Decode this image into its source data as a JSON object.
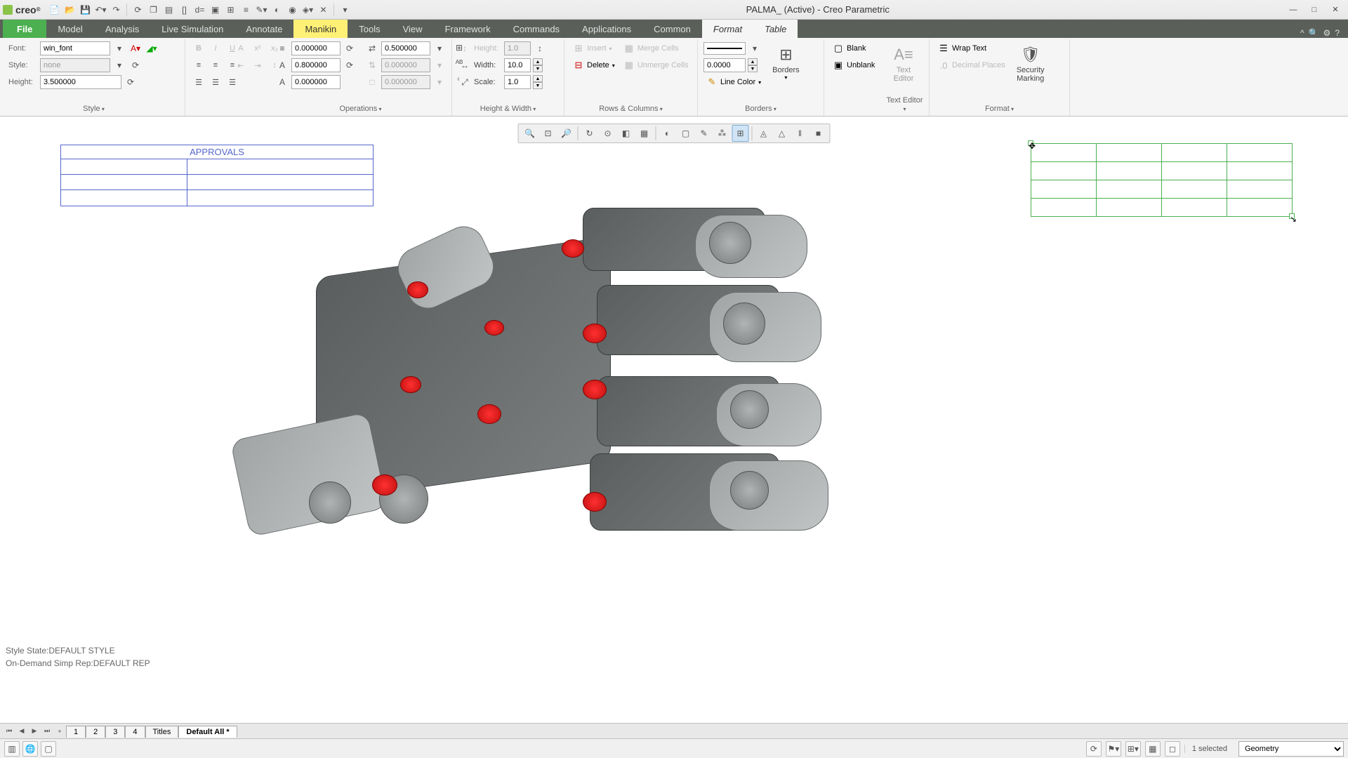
{
  "app": {
    "logo": "creo",
    "title_doc": "PALMA_ (Active)",
    "title_app": "Creo Parametric"
  },
  "qat": [
    "new",
    "open",
    "save",
    "undo",
    "redo",
    "regenerate",
    "windows",
    "close",
    "d1",
    "d2",
    "go",
    "refit",
    "dims",
    "model",
    "style",
    "render",
    "render2",
    "close2",
    "more"
  ],
  "window_controls": {
    "min": "—",
    "max": "□",
    "close": "✕"
  },
  "tabs": {
    "file": "File",
    "items": [
      "Model",
      "Analysis",
      "Live Simulation",
      "Annotate",
      "Manikin",
      "Tools",
      "View",
      "Framework",
      "Commands",
      "Applications",
      "Common",
      "Format",
      "Table"
    ],
    "active_italic": [
      "Format",
      "Table"
    ],
    "highlighted": "Manikin"
  },
  "ribbon": {
    "font": {
      "label": "Font:",
      "value": "win_font"
    },
    "style": {
      "label": "Style:",
      "value": "none"
    },
    "height": {
      "label": "Height:",
      "value": "3.500000"
    },
    "group_style": "Style",
    "line_spacing": "0.000000",
    "char_spacing": "0.800000",
    "kerning": "0.000000",
    "margin_horiz": "0.500000",
    "margin_vert": "0.000000",
    "margin_other": "0.000000",
    "group_operations": "Operations",
    "hw_height_label": "Height:",
    "hw_height_value": "1.0",
    "hw_width_label": "Width:",
    "hw_width_value": "10.0",
    "hw_scale_label": "Scale:",
    "hw_scale_value": "1.0",
    "group_hw": "Height & Width",
    "insert": "Insert",
    "delete": "Delete",
    "merge_cells": "Merge Cells",
    "unmerge_cells": "Unmerge Cells",
    "group_rc": "Rows & Columns",
    "border_width": "0.0000",
    "line_color": "Line Color",
    "borders_btn": "Borders",
    "group_borders": "Borders",
    "blank": "Blank",
    "unblank": "Unblank",
    "text_editor": "Text\nEditor",
    "group_text_editor": "Text Editor",
    "wrap_text": "Wrap Text",
    "decimal_places": "Decimal Places",
    "security_marking": "Security\nMarking",
    "group_format": "Format"
  },
  "approvals": {
    "title": "APPROVALS",
    "rows": 3
  },
  "selected_table": {
    "rows": 4,
    "cols": 4
  },
  "state": {
    "style_state": "Style State:DEFAULT STYLE",
    "simp_rep": "On-Demand Simp Rep:DEFAULT REP"
  },
  "sheets": {
    "items": [
      "1",
      "2",
      "3",
      "4",
      "Titles",
      "Default All *"
    ],
    "active": "Default All *",
    "add": "+"
  },
  "status": {
    "selected_count": "1 selected",
    "filter": "Geometry"
  }
}
